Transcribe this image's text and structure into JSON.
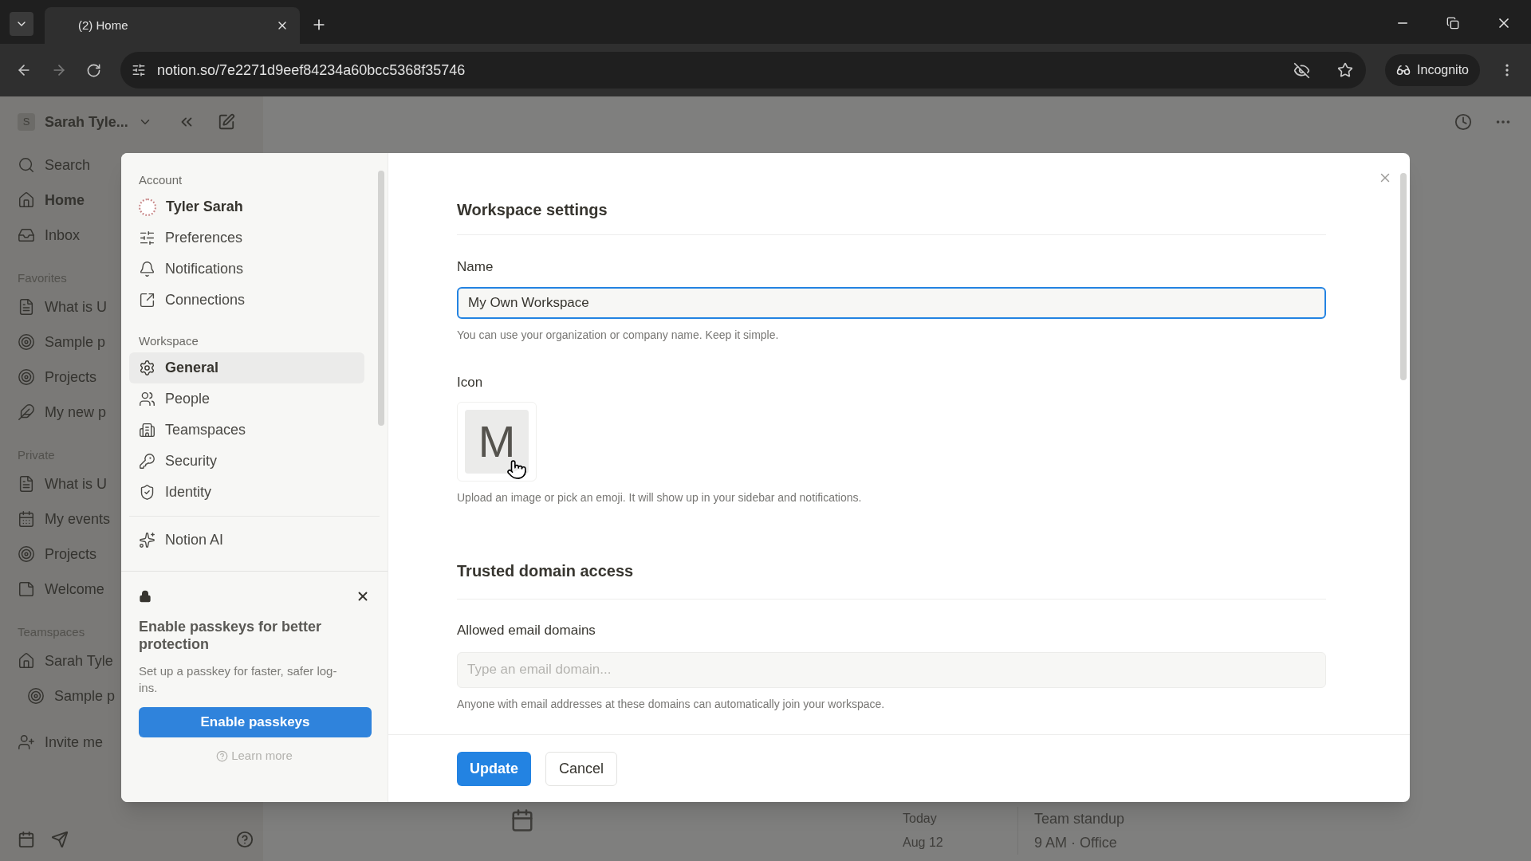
{
  "browser": {
    "tab_title": "(2) Home",
    "url": "notion.so/7e2271d9eef84234a60bcc5368f35746",
    "profile": "Incognito"
  },
  "sidebar": {
    "workspace_initial": "S",
    "workspace": "Sarah Tyle...",
    "nav": [
      {
        "label": "Search"
      },
      {
        "label": "Home"
      },
      {
        "label": "Inbox"
      }
    ],
    "sections": [
      {
        "title": "Favorites",
        "items": [
          {
            "label": "What is U"
          },
          {
            "label": "Sample p"
          },
          {
            "label": "Projects"
          },
          {
            "label": "My new p"
          }
        ]
      },
      {
        "title": "Private",
        "items": [
          {
            "label": "What is U"
          },
          {
            "label": "My events"
          },
          {
            "label": "Projects"
          },
          {
            "label": "Welcome"
          }
        ]
      },
      {
        "title": "Teamspaces",
        "items": [
          {
            "label": "Sarah Tyle"
          },
          {
            "label": "Sample p"
          }
        ]
      }
    ],
    "footer": [
      {
        "label": "Invite me"
      }
    ]
  },
  "background_event": {
    "day": "Today",
    "date": "Aug 12",
    "title": "Team standup",
    "detail": "9 AM · Office"
  },
  "settings": {
    "sections": [
      {
        "title": "Account",
        "items": [
          {
            "label": "Tyler Sarah",
            "kind": "profile",
            "selected": false
          },
          {
            "label": "Preferences",
            "kind": "link",
            "selected": false
          },
          {
            "label": "Notifications",
            "kind": "link",
            "selected": false
          },
          {
            "label": "Connections",
            "kind": "link",
            "selected": false
          }
        ]
      },
      {
        "title": "Workspace",
        "items": [
          {
            "label": "General",
            "kind": "link",
            "selected": true
          },
          {
            "label": "People",
            "kind": "link",
            "selected": false
          },
          {
            "label": "Teamspaces",
            "kind": "link",
            "selected": false
          },
          {
            "label": "Security",
            "kind": "link",
            "selected": false
          },
          {
            "label": "Identity",
            "kind": "link",
            "selected": false
          }
        ]
      },
      {
        "items": [
          {
            "label": "Notion AI",
            "kind": "link",
            "selected": false
          }
        ]
      }
    ],
    "passkey": {
      "title": "Enable passkeys for better protection",
      "text": "Set up a passkey for faster, safer log-ins.",
      "button": "Enable passkeys",
      "link": "Learn more"
    },
    "title": "Workspace settings",
    "name": {
      "label": "Name",
      "value": "My Own Workspace",
      "focused": true,
      "hint": "You can use your organization or company name. Keep it simple."
    },
    "icon": {
      "label": "Icon",
      "letter": "M",
      "hint": "Upload an image or pick an emoji. It will show up in your sidebar and notifications."
    },
    "trusted": {
      "title": "Trusted domain access",
      "label": "Allowed email domains",
      "placeholder": "Type an email domain...",
      "hint": "Anyone with email addresses at these domains can automatically join your workspace."
    },
    "buttons": [
      {
        "label": "Update",
        "kind": "primary"
      },
      {
        "label": "Cancel",
        "kind": "secondary"
      }
    ]
  }
}
